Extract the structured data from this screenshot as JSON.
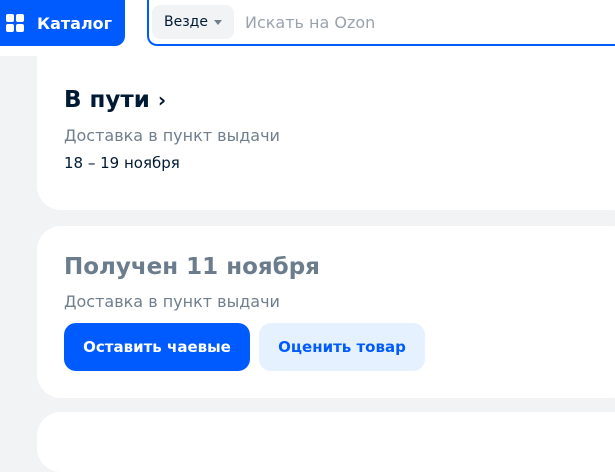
{
  "header": {
    "catalog_label": "Каталог",
    "search_scope": "Везде",
    "search_placeholder": "Искать на Ozon"
  },
  "orders": [
    {
      "title": "В пути",
      "delivery_type": "Доставка в пункт выдачи",
      "dates": "18 – 19 ноября"
    },
    {
      "title": "Получен 11 ноября",
      "delivery_type": "Доставка в пункт выдачи",
      "tip_button": "Оставить чаевые",
      "rate_button": "Оценить товар"
    }
  ],
  "colors": {
    "accent": "#005bff",
    "accent_light": "#e5f1ff",
    "text": "#001a34",
    "muted": "#707f8d",
    "background": "#f2f3f5"
  }
}
